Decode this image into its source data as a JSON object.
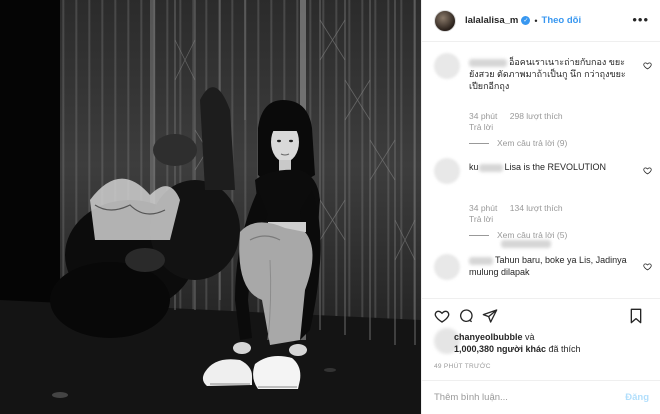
{
  "header": {
    "username": "lalalalisa_m",
    "verified_icon": "verified-badge-icon",
    "separator": "•",
    "follow_label": "Theo dõi",
    "more_icon": "more-options-icon"
  },
  "comments": [
    {
      "text": "อ็อคนเราเนาะถ่ายกับกอง ขยะยังสวย ตัดภาพมาถ้าเป็นกู นึก กว่าถุงขยะเปียกอีกถุง",
      "time": "34 phút",
      "likes": "298 lượt thích",
      "reply": "Trả lời",
      "see_replies": "Xem câu trả lời (9)"
    },
    {
      "text_visible_prefix": "ku",
      "text": "Lisa is the REVOLUTION",
      "time": "34 phút",
      "likes": "134 lượt thích",
      "reply": "Trả lời",
      "see_replies": "Xem câu trả lời (5)"
    },
    {
      "text": "Tahun baru, boke ya Lis, Jadinya mulung dilapak"
    }
  ],
  "likers": {
    "name": "chanyeolbubble",
    "and": "và",
    "count": "1,000,380",
    "others": "người khác",
    "liked": "đã thích"
  },
  "timestamp": "49 PHÚT TRƯỚC",
  "add_comment": {
    "placeholder": "Thêm bình luận...",
    "post_label": "Đăng"
  },
  "colors": {
    "accent": "#3897f0",
    "post_disabled": "#b2dffc",
    "muted": "#999999",
    "text": "#262626"
  }
}
